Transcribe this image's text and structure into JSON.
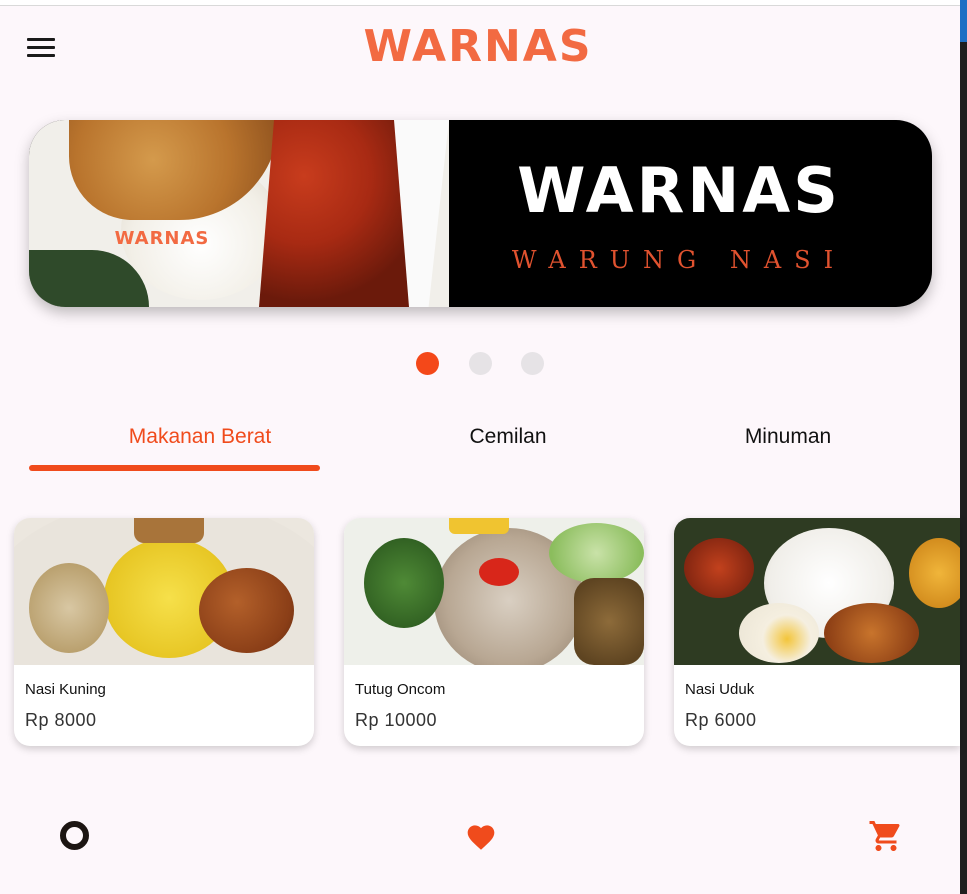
{
  "app": {
    "brand": "WARNAS"
  },
  "banner": {
    "small_brand": "WARNAS",
    "brand": "WARNAS",
    "subtitle": "WARUNG NASI",
    "slides": 3,
    "active_slide": 1
  },
  "tabs": [
    {
      "label": "Makanan Berat",
      "active": true
    },
    {
      "label": "Cemilan",
      "active": false
    },
    {
      "label": "Minuman",
      "active": false
    }
  ],
  "products": [
    {
      "name": "Nasi Kuning",
      "price": "Rp 8000"
    },
    {
      "name": "Tutug Oncom",
      "price": "Rp 10000"
    },
    {
      "name": "Nasi Uduk",
      "price": "Rp 6000"
    }
  ],
  "bottom_nav": [
    {
      "icon": "home-ring-icon"
    },
    {
      "icon": "heart-icon"
    },
    {
      "icon": "cart-icon"
    }
  ],
  "colors": {
    "accent": "#f04b1c",
    "brand": "#f26a42",
    "background": "#fdf7fb"
  }
}
